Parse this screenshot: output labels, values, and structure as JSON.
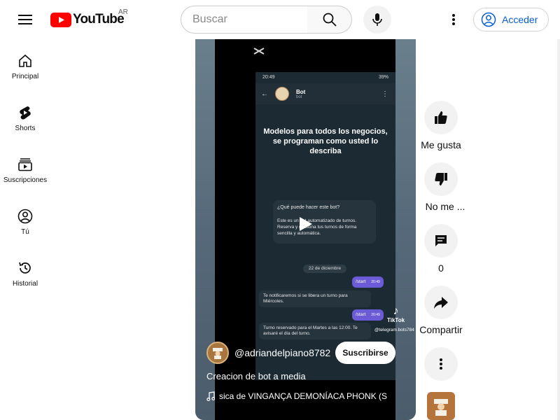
{
  "header": {
    "logo_text": "YouTube",
    "region": "AR",
    "search_placeholder": "Buscar",
    "signin_label": "Acceder"
  },
  "sidebar": {
    "items": [
      {
        "label": "Principal",
        "icon": "home-icon"
      },
      {
        "label": "Shorts",
        "icon": "shorts-icon"
      },
      {
        "label": "Suscripciones",
        "icon": "subscriptions-icon"
      },
      {
        "label": "Tú",
        "icon": "you-icon"
      },
      {
        "label": "Historial",
        "icon": "history-icon"
      }
    ]
  },
  "video": {
    "phone": {
      "status_time": "20:49",
      "status_battery": "39%",
      "bot_name": "Bot",
      "bot_sub": "bot",
      "headline": "Modelos para todos los negocios, se programan como usted lo describa",
      "card_title": "¿Qué puede hacer este bot?",
      "card_body": "Este es un bot automatizado de turnos. Reserva y gestiona tus turnos de forma sencilla y automática.",
      "date_label": "22 de diciembre",
      "msg_start": "/start",
      "msg_time": "20:49",
      "msg_notify": "Te notificaremos si se libera un turno para Miércoles.",
      "msg_reserved": "Turno reservado para el Martes a las 12:00. Te avisaré el día del turno."
    },
    "tiktok_label": "TikTok",
    "tiktok_handle": "@telegram.bots784",
    "channel_handle": "@adriandelpiano8782",
    "subscribe_label": "Suscribirse",
    "title": "Creacion de bot a media",
    "music": "sica de VINGANÇA DEMONÍACA PHONK (S"
  },
  "actions": {
    "like_label": "Me gusta",
    "dislike_label": "No me ...",
    "comments_count": "0",
    "share_label": "Compartir"
  },
  "colors": {
    "brand_red": "#ff0000",
    "link_blue": "#065fd4",
    "telegram_purple": "#6b5bd6"
  }
}
